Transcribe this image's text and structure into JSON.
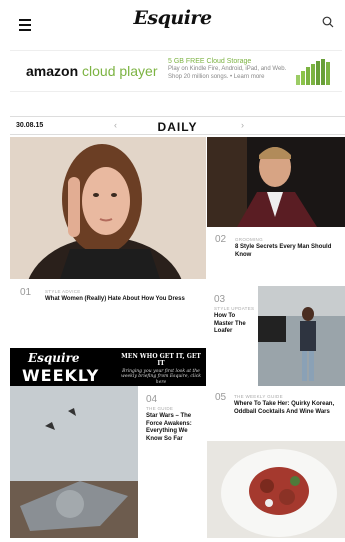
{
  "header": {
    "logo": "Esquire"
  },
  "ad": {
    "brand": "amazon",
    "product": "cloud player",
    "headline": "5 GB FREE Cloud Storage",
    "line1": "Play on Kindle Fire, Android, iPad, and Web.",
    "line2": "Shop 20 million songs. • Learn more",
    "accent": "#7cb342"
  },
  "datebar": {
    "date": "30.08.15",
    "title": "DAILY",
    "prev_icon": "chevron-left",
    "next_icon": "chevron-right"
  },
  "stories": [
    {
      "num": "01",
      "kicker": "STYLE ADVICE",
      "title": "What Women (Really) Hate About How You Dress"
    },
    {
      "num": "02",
      "kicker": "GROOMING",
      "title": "8 Style Secrets Every Man Should Know"
    },
    {
      "num": "03",
      "kicker": "STYLE UPDATES",
      "title": "How To Master The Loafer"
    },
    {
      "num": "04",
      "kicker": "THE GUIDE",
      "title": "Star Wars – The Force Awakens: Everything We Know So Far"
    },
    {
      "num": "05",
      "kicker": "THE WEEKLY GUIDE",
      "title": "Where To Take Her: Quirky Korean, Oddball Cocktails And Wine Wars"
    }
  ],
  "weekly": {
    "logo": "Esquire",
    "name": "WEEKLY",
    "tagline": "MEN WHO GET IT, GET IT",
    "subtext": "Bringing you your first look at the weekly briefing from Esquire, click here"
  }
}
